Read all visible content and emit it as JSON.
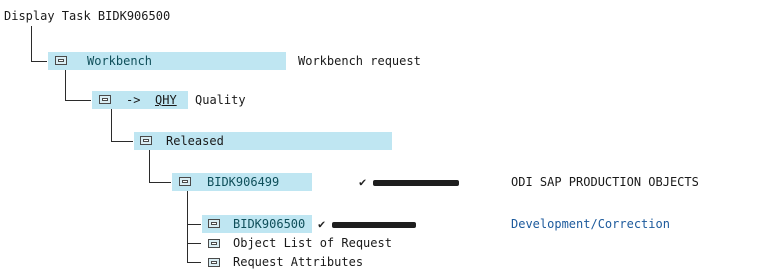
{
  "title": "Display Task BIDK906500",
  "tree": {
    "workbench": {
      "label": "Workbench",
      "description": "Workbench request"
    },
    "target": {
      "arrow": "->",
      "system": "QHY",
      "label": "Quality"
    },
    "released": {
      "label": "Released"
    },
    "parent_request": {
      "id": "BIDK906499",
      "check": "✔",
      "description": "ODI SAP PRODUCTION OBJECTS"
    },
    "task": {
      "id": "BIDK906500",
      "check": "✔",
      "description": "Development/Correction"
    },
    "object_list": {
      "label": "Object List of Request"
    },
    "request_attributes": {
      "label": "Request Attributes"
    }
  },
  "colors": {
    "highlight": "#bfe6f2",
    "link_blue": "#1c5a9c",
    "redaction": "#1e1e1e"
  },
  "icons": [
    "folder-icon",
    "checkmark-icon"
  ]
}
